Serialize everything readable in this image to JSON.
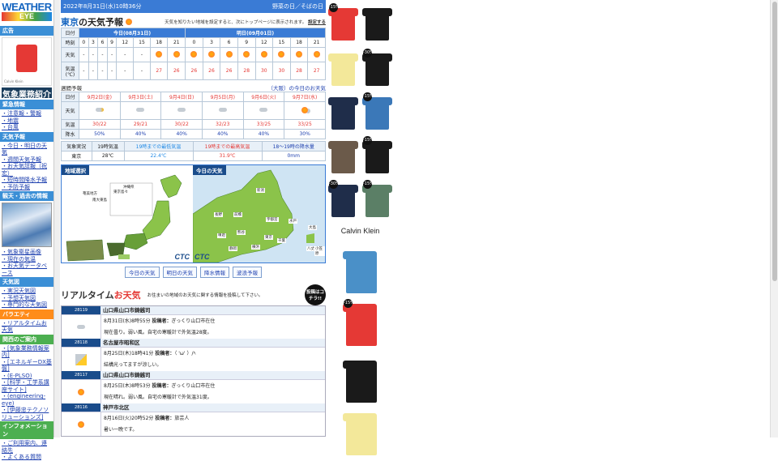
{
  "logo": {
    "line1": "WEATHER",
    "line2": "EYE"
  },
  "left": {
    "ad_header": "広告",
    "ad_brand": "Calvin Klein",
    "kisho_title": "気象業務紹介",
    "sections": [
      {
        "title": "緊急情報",
        "color": "b",
        "items": [
          "注意報・警報",
          "地震",
          "台風"
        ]
      },
      {
        "title": "天気予報",
        "color": "b",
        "items": [
          "今日・明日の天気",
          "週間天気予報",
          "お天気詳報（祝宏）",
          "短時間降水予報",
          "予防予報"
        ]
      },
      {
        "title": "観天・過去の情報",
        "color": "b",
        "items": []
      },
      {
        "title": "",
        "color": "b",
        "items": [
          "気象衛星画像",
          "現在の気温",
          "お天気データベース"
        ]
      },
      {
        "title": "天気図",
        "color": "b",
        "items": [
          "実況天気図",
          "予想天気図",
          "専門的な天気図"
        ]
      },
      {
        "title": "バラエティ",
        "color": "o",
        "items": [
          "リアルタイムお天気"
        ]
      },
      {
        "title": "関西のご案内",
        "color": "g",
        "items": [
          "[気象業務情報案内]",
          "[エネルギーDX基盤]",
          "(E-PLSO)",
          "[科学・工学系講座サイト]",
          "(engineering-eye)",
          "[伊藤忠テクノソリューションズ]"
        ]
      },
      {
        "title": "インフォメーション",
        "color": "g",
        "items": [
          "ご利用案内、連絡先",
          "よくある質問"
        ]
      }
    ]
  },
  "topbar": {
    "left": "2022年8月31日(水)10時36分",
    "right": "野菜の日／そばの日"
  },
  "forecast": {
    "title": "東京",
    "title_suffix": "の天気予報",
    "note": "天気を知りたい地域を設定すると、次にトップページに表示されます。",
    "setting": "設定する",
    "today": "今日(08月31日)",
    "tomorrow": "明日(09月01日)",
    "labels": {
      "date": "日付",
      "time": "時刻",
      "weather": "天気",
      "temp": "気温(℃)"
    },
    "hours": [
      "0",
      "3",
      "6",
      "9",
      "12",
      "15",
      "18",
      "21",
      "0",
      "3",
      "6",
      "9",
      "12",
      "15",
      "18",
      "21"
    ],
    "weather": [
      "-",
      "-",
      "-",
      "-",
      "-",
      "-",
      "sun",
      "sun",
      "sun",
      "sun",
      "sun",
      "sun",
      "sun",
      "sun",
      "sun",
      "sun"
    ],
    "temps": [
      "-",
      "-",
      "-",
      "-",
      "-",
      "-",
      "27",
      "26",
      "26",
      "26",
      "26",
      "28",
      "30",
      "30",
      "28",
      "27"
    ]
  },
  "weekly": {
    "title": "週間予報",
    "region_link": "（大阪）の今日のお天気",
    "labels": {
      "date": "日付",
      "weather": "天気",
      "temp": "気温",
      "rain": "降水"
    },
    "days": [
      {
        "date": "9月2日(金)",
        "icon": "cloud-sun",
        "temp": "30/22",
        "rain": "50%"
      },
      {
        "date": "9月3日(土)",
        "icon": "cloud",
        "temp": "29/21",
        "rain": "40%"
      },
      {
        "date": "9月4日(日)",
        "icon": "cloud",
        "temp": "30/22",
        "rain": "40%"
      },
      {
        "date": "9月5日(月)",
        "icon": "cloud",
        "temp": "32/23",
        "rain": "40%"
      },
      {
        "date": "9月6日(火)",
        "icon": "cloud",
        "temp": "33/25",
        "rain": "40%"
      },
      {
        "date": "9月7日(水)",
        "icon": "sun-cloud",
        "temp": "33/25",
        "rain": "30%"
      }
    ]
  },
  "obs": {
    "headers": [
      "気象実況",
      "19時気温",
      "19時までの最低気温",
      "19時までの最高気温",
      "18～19時の降水量"
    ],
    "values": [
      "東京",
      "28℃",
      "22.4℃",
      "31.9℃",
      "0mm"
    ]
  },
  "maps": {
    "left_title": "地域選択",
    "right_title": "今日の天気",
    "left_labels": [
      "沖縄県",
      "奄美地方",
      "東京島々",
      "南大東島"
    ],
    "right_labels": [
      "新潟",
      "長野",
      "前橋",
      "宇都宮",
      "水戸",
      "甲府",
      "熊谷",
      "東京",
      "横浜",
      "千葉",
      "静岡",
      "大島",
      "八丈島",
      "小笠原"
    ],
    "logo": "CTC"
  },
  "buttons": [
    "今日の天気",
    "明日の天気",
    "降水情報",
    "波浪予報"
  ],
  "realtime": {
    "logo1": "リアルタイム",
    "logo2": "お天気",
    "desc": "お住まいの地域のお天気に関する情報を投稿して下さい。",
    "badge": "投稿はコチラ!!",
    "posts": [
      {
        "num": "28119",
        "place": "山口県山口市鋳銭司",
        "time": "8月31日(水)8時55分",
        "poster_label": "投稿者：",
        "poster": "ぎっくり山口市在住",
        "text": "現在曇り。弱い風。自宅の寒暖計で外気温28度。",
        "icon": "cloud"
      },
      {
        "num": "28118",
        "place": "名古屋市昭和区",
        "time": "8月25日(木)18時41分",
        "poster_label": "投稿者：",
        "poster": "（ 'ω' ）/ﾍ",
        "text": "結構光ってますが涼しい。",
        "icon": "thunder"
      },
      {
        "num": "28117",
        "place": "山口県山口市鋳銭司",
        "time": "8月25日(木)8時53分",
        "poster_label": "投稿者：",
        "poster": "ぎっくり山口市在住",
        "text": "現在晴れ。弱い風。自宅の寒暖計で外気温31度。",
        "icon": "sun"
      },
      {
        "num": "28116",
        "place": "神戸市北区",
        "time": "8月16日(火)20時52分",
        "poster_label": "投稿者：",
        "poster": "旅芸人",
        "text": "暑い一晩です。",
        "icon": "sun"
      }
    ]
  },
  "ads": {
    "brand": "Calvin Klein",
    "badges": [
      "-15%",
      "-30%",
      "-15%",
      "-15%",
      "-30%",
      "-15%",
      "-15%"
    ],
    "colors": {
      "red": "#e53935",
      "black": "#1a1a1a",
      "yellow": "#f3e89a",
      "navy": "#1f2d4a",
      "blue": "#3b78b8",
      "brown": "#6b5a4a",
      "green": "#5b7f66",
      "lblue": "#4a90c8"
    }
  }
}
